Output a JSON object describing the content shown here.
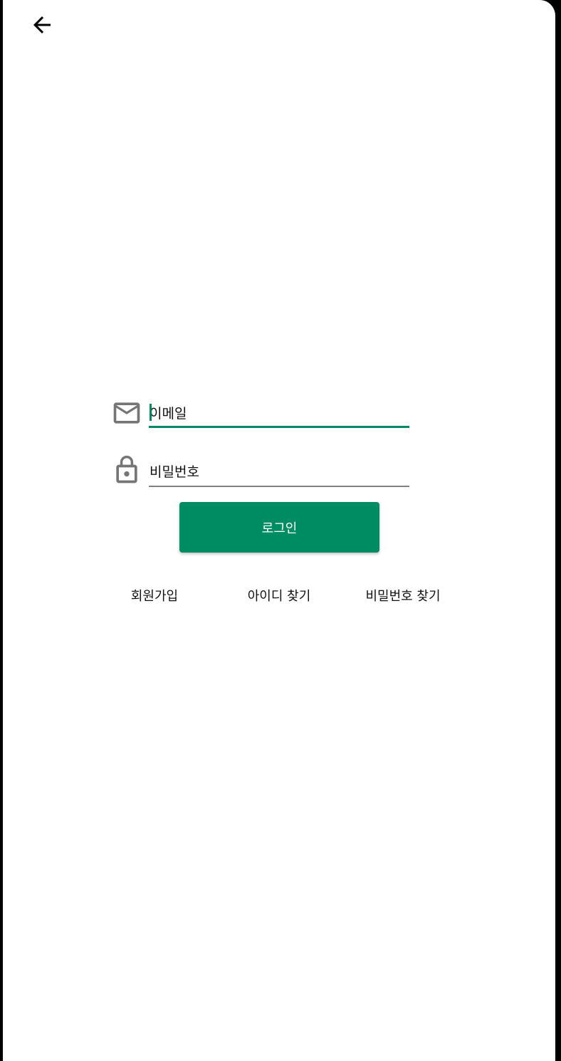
{
  "header": {
    "back_icon": "arrow-left-icon"
  },
  "form": {
    "email": {
      "icon": "mail-icon",
      "placeholder": "이메일",
      "value": "",
      "focused": true
    },
    "password": {
      "icon": "lock-icon",
      "placeholder": "비밀번호",
      "value": ""
    },
    "login_label": "로그인"
  },
  "links": {
    "signup": "회원가입",
    "find_id": "아이디 찾기",
    "find_password": "비밀번호 찾기"
  },
  "colors": {
    "accent": "#00876B",
    "button": "#008C63",
    "icon": "#757575",
    "underline_inactive": "#808080"
  }
}
